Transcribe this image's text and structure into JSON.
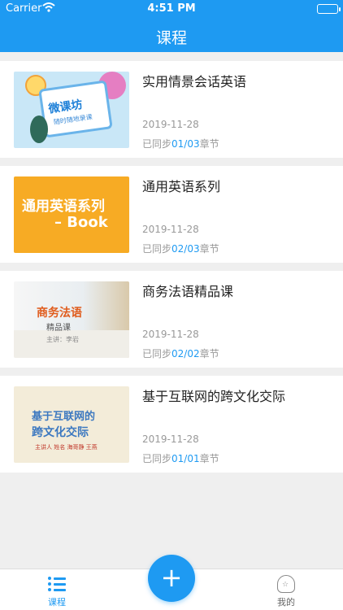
{
  "status": {
    "carrier": "Carrier",
    "time": "4:51 PM"
  },
  "header": {
    "title": "课程"
  },
  "courses": [
    {
      "name": "实用情景会话英语",
      "date": "2019-11-28",
      "sync_prefix": "已同步",
      "progress": "01/03",
      "sync_suffix": "章节",
      "thumb": {
        "line1": "微课坊",
        "line2": "随时随地录课"
      }
    },
    {
      "name": "通用英语系列",
      "date": "2019-11-28",
      "sync_prefix": "已同步",
      "progress": "02/03",
      "sync_suffix": "章节",
      "thumb": {
        "line1": "通用英语系列",
        "line2": "– Book"
      }
    },
    {
      "name": "商务法语精品课",
      "date": "2019-11-28",
      "sync_prefix": "已同步",
      "progress": "02/02",
      "sync_suffix": "章节",
      "thumb": {
        "line1": "商务法语",
        "line2": "精品课",
        "line3": "主讲：李岩"
      }
    },
    {
      "name": "基于互联网的跨文化交际",
      "date": "2019-11-28",
      "sync_prefix": "已同步",
      "progress": "01/01",
      "sync_suffix": "章节",
      "thumb": {
        "line1": "基于互联网的",
        "line2": "跨文化交际",
        "line3": "主讲人  姓名  海哥静 王燕"
      }
    }
  ],
  "tabbar": {
    "course_label": "课程",
    "mine_label": "我的",
    "add_symbol": "+"
  },
  "colors": {
    "accent": "#1e9af2",
    "background": "#efefef"
  }
}
